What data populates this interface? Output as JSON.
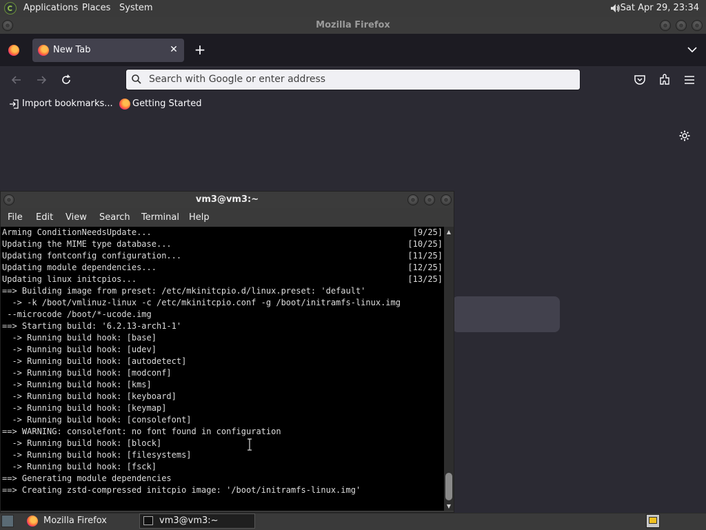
{
  "top_panel": {
    "menus": [
      "Applications",
      "Places",
      "System"
    ],
    "clock": "Sat Apr 29, 23:34"
  },
  "firefox": {
    "window_title": "Mozilla Firefox",
    "tab": {
      "label": "New Tab"
    },
    "urlbar": {
      "placeholder": "Search with Google or enter address"
    },
    "bookmarks": [
      "Import bookmarks...",
      "Getting Started"
    ]
  },
  "terminal": {
    "window_title": "vm3@vm3:~",
    "menus": [
      "File",
      "Edit",
      "View",
      "Search",
      "Terminal",
      "Help"
    ],
    "lines": [
      {
        "text": "Arming ConditionNeedsUpdate...",
        "right": "[9/25]"
      },
      {
        "text": "Updating the MIME type database...",
        "right": "[10/25]"
      },
      {
        "text": "Updating fontconfig configuration...",
        "right": "[11/25]"
      },
      {
        "text": "Updating module dependencies...",
        "right": "[12/25]"
      },
      {
        "text": "Updating linux initcpios...",
        "right": "[13/25]"
      },
      {
        "text": "==> Building image from preset: /etc/mkinitcpio.d/linux.preset: 'default'",
        "right": ""
      },
      {
        "text": "  -> -k /boot/vmlinuz-linux -c /etc/mkinitcpio.conf -g /boot/initramfs-linux.img",
        "right": ""
      },
      {
        "text": " --microcode /boot/*-ucode.img",
        "right": ""
      },
      {
        "text": "==> Starting build: '6.2.13-arch1-1'",
        "right": ""
      },
      {
        "text": "  -> Running build hook: [base]",
        "right": ""
      },
      {
        "text": "  -> Running build hook: [udev]",
        "right": ""
      },
      {
        "text": "  -> Running build hook: [autodetect]",
        "right": ""
      },
      {
        "text": "  -> Running build hook: [modconf]",
        "right": ""
      },
      {
        "text": "  -> Running build hook: [kms]",
        "right": ""
      },
      {
        "text": "  -> Running build hook: [keyboard]",
        "right": ""
      },
      {
        "text": "  -> Running build hook: [keymap]",
        "right": ""
      },
      {
        "text": "  -> Running build hook: [consolefont]",
        "right": ""
      },
      {
        "text": "==> WARNING: consolefont: no font found in configuration",
        "right": ""
      },
      {
        "text": "  -> Running build hook: [block]",
        "right": ""
      },
      {
        "text": "  -> Running build hook: [filesystems]",
        "right": ""
      },
      {
        "text": "  -> Running build hook: [fsck]",
        "right": ""
      },
      {
        "text": "==> Generating module dependencies",
        "right": ""
      },
      {
        "text": "==> Creating zstd-compressed initcpio image: '/boot/initramfs-linux.img'",
        "right": ""
      }
    ]
  },
  "taskbar": {
    "items": [
      "Mozilla Firefox",
      "vm3@vm3:~"
    ]
  },
  "colors": {
    "firefox_bg": "#2b2a33",
    "terminal_bg": "#000000",
    "panel_bg": "#3a3a3a"
  }
}
